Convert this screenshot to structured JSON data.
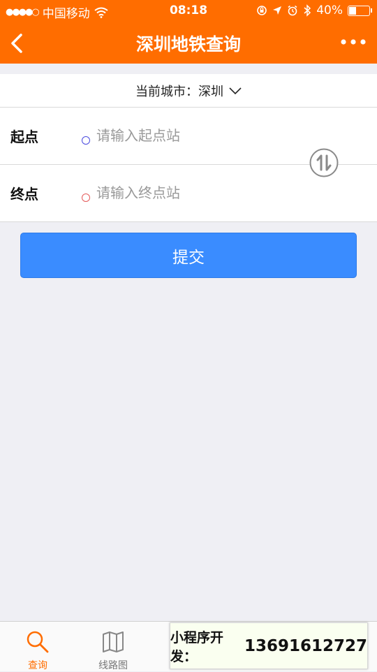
{
  "status_bar": {
    "signal_dots": "●●●●○",
    "carrier": "中国移动",
    "time": "08:18",
    "battery_percent": "40%",
    "battery_level": 0.4
  },
  "nav": {
    "title": "深圳地铁查询",
    "back_icon": "chevron-left-icon",
    "more_icon": "more-dots-icon"
  },
  "city": {
    "label": "当前城市：",
    "value": "深圳"
  },
  "route": {
    "start_label": "起点",
    "start_placeholder": "请输入起点站",
    "start_value": "",
    "start_dot_color": "#4a4adf",
    "end_label": "终点",
    "end_placeholder": "请输入终点站",
    "end_value": "",
    "end_dot_color": "#e45a5a"
  },
  "submit_label": "提交",
  "tabbar": {
    "tabs": [
      {
        "label": "查询",
        "icon": "search-icon",
        "active": true
      },
      {
        "label": "线路图",
        "icon": "map-icon",
        "active": false
      },
      {
        "label": "",
        "icon": "",
        "active": false
      },
      {
        "label": "",
        "icon": "",
        "active": false
      },
      {
        "label": "",
        "icon": "",
        "active": false
      }
    ]
  },
  "overlay": {
    "prefix": "小程序开发：",
    "phone": "13691612727"
  },
  "colors": {
    "brand": "#ff6d00",
    "button": "#3a8cff",
    "background": "#efeff4"
  }
}
